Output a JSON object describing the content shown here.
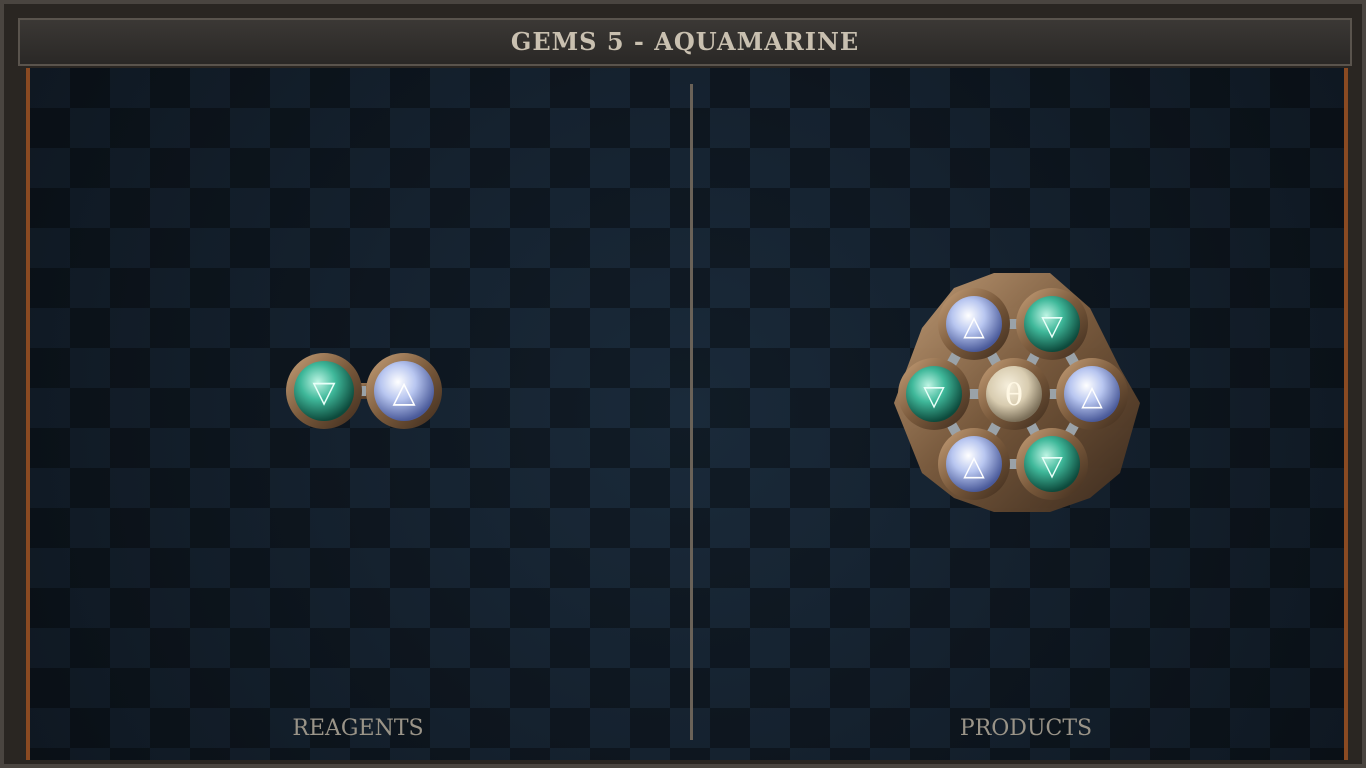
{
  "title": "GEMS 5 - AQUAMARINE",
  "panels": {
    "reagents_label": "REAGENTS",
    "products_label": "PRODUCTS"
  },
  "molecules": {
    "reagent": {
      "atoms": [
        {
          "element": "water",
          "symbol": "▽"
        },
        {
          "element": "air",
          "symbol": "△"
        }
      ],
      "bonds": 1
    },
    "product": {
      "atoms": [
        {
          "element": "salt",
          "symbol": "θ",
          "role": "center"
        },
        {
          "element": "air",
          "symbol": "△",
          "role": "top-left"
        },
        {
          "element": "water",
          "symbol": "▽",
          "role": "top-right"
        },
        {
          "element": "water",
          "symbol": "▽",
          "role": "left"
        },
        {
          "element": "air",
          "symbol": "△",
          "role": "right"
        },
        {
          "element": "air",
          "symbol": "△",
          "role": "bottom-left"
        },
        {
          "element": "water",
          "symbol": "▽",
          "role": "bottom-right"
        }
      ],
      "bonds": 12
    }
  },
  "colors": {
    "water": "#3fb89a",
    "air": "#b8c6f0",
    "salt": "#d8ccb0",
    "frame_accent": "#8a4a22"
  }
}
